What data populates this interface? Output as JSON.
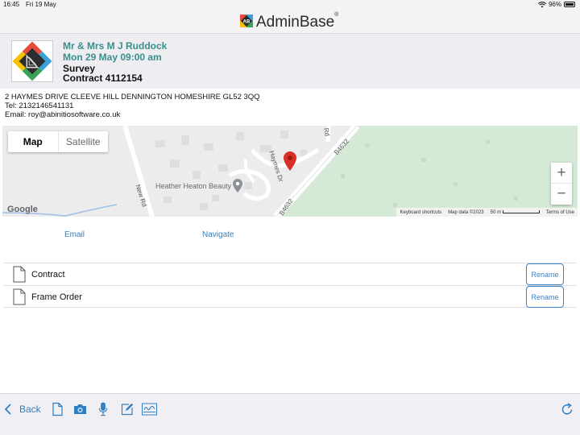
{
  "status_bar": {
    "time": "16:45",
    "date": "Fri 19 May",
    "battery": "96%"
  },
  "header": {
    "title": "AdminBase",
    "trademark": "®"
  },
  "appointment": {
    "client": "Mr & Mrs M J Ruddock",
    "date_time": "Mon 29 May 09:00 am",
    "type": "Survey",
    "contract": "Contract 4112154"
  },
  "contact": {
    "address": "2 HAYMES DRIVE CLEEVE HILL DENNINGTON HOMESHIRE GL52 3QQ",
    "tel": "Tel: 2132146541131",
    "email": "Email: roy@abinitiosoftware.co.uk"
  },
  "map": {
    "tab_map": "Map",
    "tab_satellite": "Satellite",
    "zoom_in": "+",
    "zoom_out": "−",
    "road_new": "New Rd",
    "road_haymes": "Haymes Dr",
    "road_b4632_a": "B4632",
    "road_b4632_b": "B4632",
    "road_rd": "Rd",
    "poi": "Heather Heaton Beauty",
    "google": "Google",
    "shortcuts": "Keyboard shortcuts",
    "map_data": "Map data ©2023",
    "scale": "50 m",
    "terms": "Terms of Use"
  },
  "actions": {
    "email": "Email",
    "navigate": "Navigate"
  },
  "documents": [
    {
      "name": "Contract",
      "button": "Rename"
    },
    {
      "name": "Frame Order",
      "button": "Rename"
    }
  ],
  "toolbar": {
    "back": "Back"
  },
  "colors": {
    "accent": "#2f7fc1",
    "teal": "#3a8f8c",
    "pin": "#d93025",
    "park": "#d4e9d6"
  }
}
